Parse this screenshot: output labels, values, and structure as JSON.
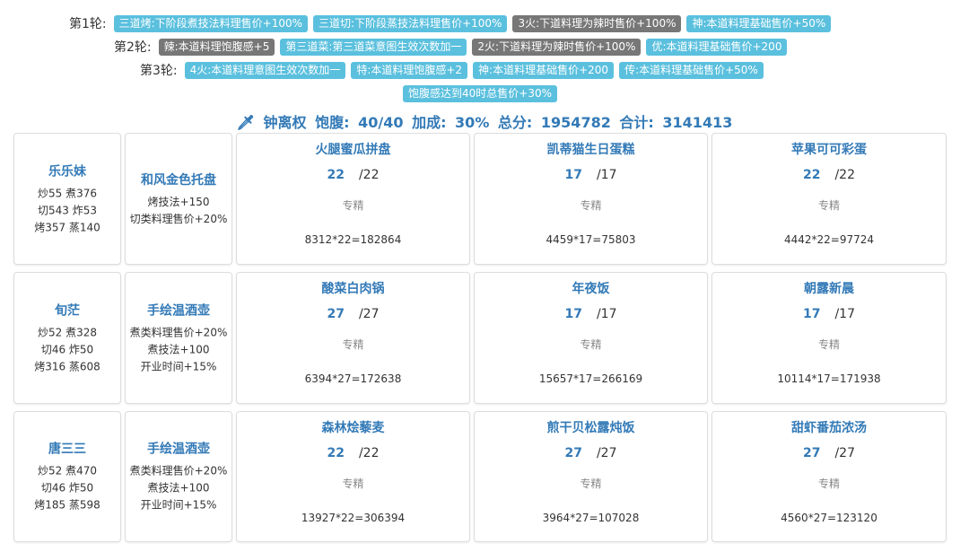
{
  "rounds": [
    {
      "label": "第1轮:",
      "tags": [
        {
          "text": "三道烤:下阶段煮技法料理售价+100%",
          "color": "blue"
        },
        {
          "text": "三道切:下阶段蒸技法料理售价+100%",
          "color": "blue"
        },
        {
          "text": "3火:下道料理为辣时售价+100%",
          "color": "grey"
        },
        {
          "text": "神:本道料理基础售价+50%",
          "color": "blue"
        }
      ]
    },
    {
      "label": "第2轮:",
      "tags": [
        {
          "text": "辣:本道料理饱腹感+5",
          "color": "grey"
        },
        {
          "text": "第三道菜:第三道菜意图生效次数加一",
          "color": "blue"
        },
        {
          "text": "2火:下道料理为辣时售价+100%",
          "color": "grey"
        },
        {
          "text": "优:本道料理基础售价+200",
          "color": "blue"
        }
      ]
    },
    {
      "label": "第3轮:",
      "tags": [
        {
          "text": "4火:本道料理意图生效次数加一",
          "color": "blue"
        },
        {
          "text": "特:本道料理饱腹感+2",
          "color": "blue"
        },
        {
          "text": "神:本道料理基础售价+200",
          "color": "blue"
        },
        {
          "text": "传:本道料理基础售价+50%",
          "color": "blue"
        }
      ]
    }
  ],
  "extra_tag": {
    "text": "饱腹感达到40时总售价+30%",
    "color": "blue"
  },
  "summary": {
    "icon": "sword-icon",
    "name": "钟离权",
    "fullness_label": "饱腹:",
    "fullness": "40/40",
    "bonus_label": "加成:",
    "bonus": "30%",
    "total_label": "总分:",
    "total": "1954782",
    "sum_label": "合计:",
    "sum": "3141413"
  },
  "rows": [
    {
      "chef": {
        "name": "乐乐妹",
        "stats": [
          "炒55 煮376",
          "切543 炸53",
          "烤357 蒸140"
        ]
      },
      "equip": {
        "name": "和风金色托盘",
        "effects": [
          "烤技法+150",
          "切类料理售价+20%"
        ]
      },
      "dishes": [
        {
          "name": "火腿蜜瓜拼盘",
          "qty": "22",
          "max": "/22",
          "skill": "专精",
          "calc": "8312*22=182864"
        },
        {
          "name": "凯蒂猫生日蛋糕",
          "qty": "17",
          "max": "/17",
          "skill": "专精",
          "calc": "4459*17=75803"
        },
        {
          "name": "苹果可可彩蛋",
          "qty": "22",
          "max": "/22",
          "skill": "专精",
          "calc": "4442*22=97724"
        }
      ]
    },
    {
      "chef": {
        "name": "旬茫",
        "stats": [
          "炒52 煮328",
          "切46 炸50",
          "烤316 蒸608"
        ]
      },
      "equip": {
        "name": "手绘温酒壶",
        "effects": [
          "煮类料理售价+20%",
          "煮技法+100",
          "开业时间+15%"
        ]
      },
      "dishes": [
        {
          "name": "酸菜白肉锅",
          "qty": "27",
          "max": "/27",
          "skill": "专精",
          "calc": "6394*27=172638"
        },
        {
          "name": "年夜饭",
          "qty": "17",
          "max": "/17",
          "skill": "专精",
          "calc": "15657*17=266169"
        },
        {
          "name": "朝露新晨",
          "qty": "17",
          "max": "/17",
          "skill": "专精",
          "calc": "10114*17=171938"
        }
      ]
    },
    {
      "chef": {
        "name": "唐三三",
        "stats": [
          "炒52 煮470",
          "切46 炸50",
          "烤185 蒸598"
        ]
      },
      "equip": {
        "name": "手绘温酒壶",
        "effects": [
          "煮类料理售价+20%",
          "煮技法+100",
          "开业时间+15%"
        ]
      },
      "dishes": [
        {
          "name": "森林烩藜麦",
          "qty": "22",
          "max": "/22",
          "skill": "专精",
          "calc": "13927*22=306394"
        },
        {
          "name": "煎干贝松露炖饭",
          "qty": "27",
          "max": "/27",
          "skill": "专精",
          "calc": "3964*27=107028"
        },
        {
          "name": "甜虾番茄浓汤",
          "qty": "27",
          "max": "/27",
          "skill": "专精",
          "calc": "4560*27=123120"
        }
      ]
    }
  ]
}
